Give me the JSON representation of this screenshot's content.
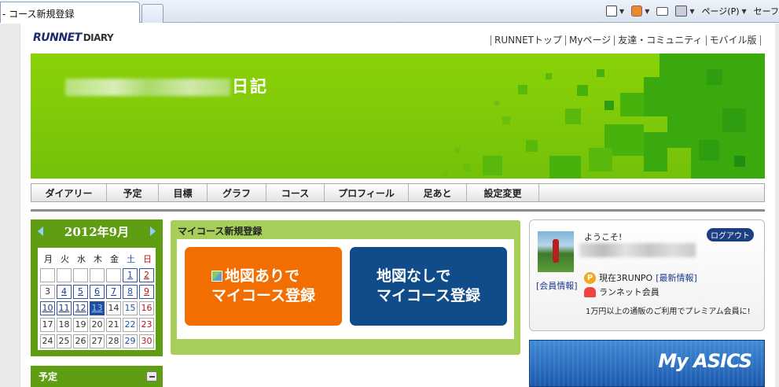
{
  "browser": {
    "tab_title": "- コース新規登録",
    "toolbar": {
      "page_label": "ページ(P)",
      "safety_label": "セーフ"
    }
  },
  "site": {
    "logo_text": "RUNNET",
    "logo_suffix": "DIARY",
    "top_links": [
      "RUNNETトップ",
      "Myページ",
      "友達・コミュニティ",
      "モバイル版"
    ]
  },
  "banner": {
    "title": "日記"
  },
  "nav": {
    "items": [
      "ダイアリー",
      "予定",
      "目標",
      "グラフ",
      "コース",
      "プロフィール",
      "足あと",
      "設定変更"
    ]
  },
  "calendar": {
    "month_label": "2012年9月",
    "weekdays": [
      "月",
      "火",
      "水",
      "木",
      "金",
      "土",
      "日"
    ],
    "days": [
      "",
      "",
      "",
      "",
      "",
      "1",
      "2",
      "3",
      "4",
      "5",
      "6",
      "7",
      "8",
      "9",
      "10",
      "11",
      "12",
      "13",
      "14",
      "15",
      "16",
      "17",
      "18",
      "19",
      "20",
      "21",
      "22",
      "23",
      "24",
      "25",
      "26",
      "27",
      "28",
      "29",
      "30"
    ],
    "linked_days": [
      1,
      2,
      4,
      5,
      6,
      7,
      8,
      9,
      10,
      11,
      12,
      13
    ],
    "today": 13
  },
  "schedule": {
    "label": "予定"
  },
  "course_panel": {
    "title": "マイコース新規登録",
    "with_map": {
      "line1": "地図ありで",
      "line2": "マイコース登録"
    },
    "without_map": {
      "line1": "地図なしで",
      "line2": "マイコース登録"
    }
  },
  "member": {
    "welcome": "ようこそ!",
    "logout": "ログアウト",
    "member_info": "[会員情報]",
    "runpo_text": "現在3RUNPO",
    "runpo_link": "[最新情報]",
    "runnet_member": "ランネット会員",
    "promo": "1万円以上の通販のご利用でプレミアム会員に!"
  },
  "ad": {
    "text": "My ASICS"
  },
  "colors": {
    "banner_green": "#7ec80a",
    "panel_green": "#a5cf58",
    "orange": "#f26e00",
    "blue": "#114c8a",
    "calendar_green": "#5f9e13"
  }
}
